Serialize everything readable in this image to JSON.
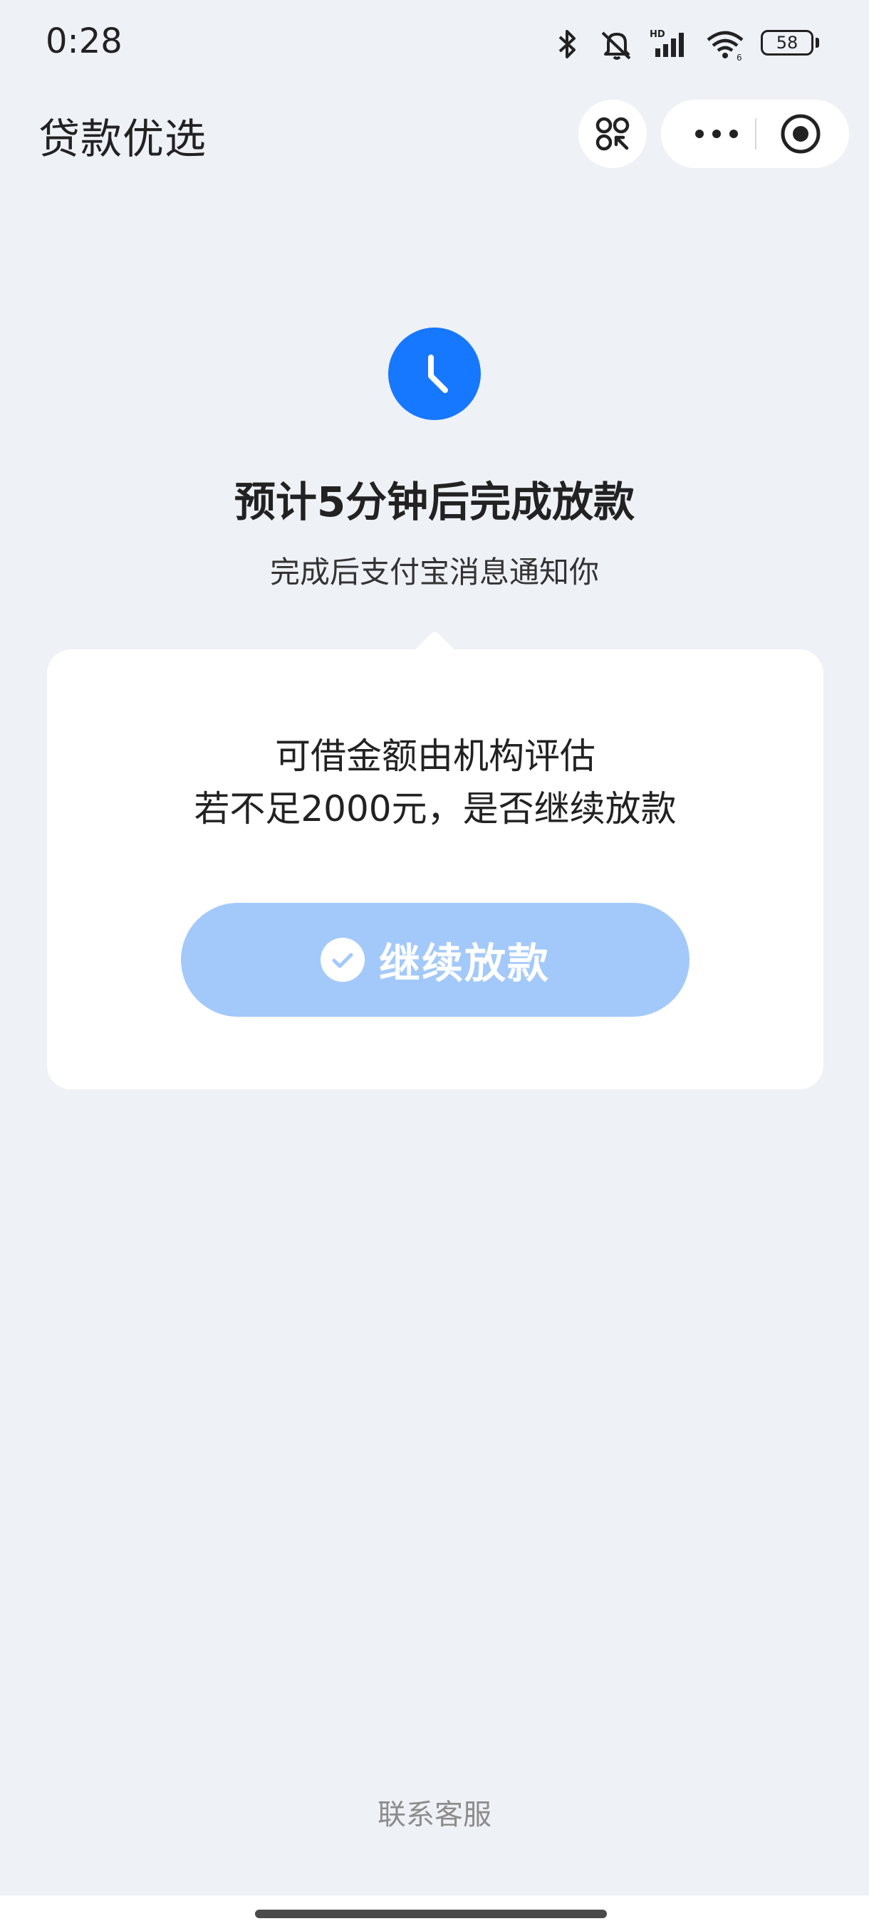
{
  "status_bar": {
    "time": "0:28",
    "battery_level": "58",
    "icons": [
      "bluetooth-icon",
      "mute-icon",
      "signal-icon",
      "wifi-icon",
      "battery-icon"
    ]
  },
  "nav": {
    "title": "贷款优选",
    "icons": [
      "scan-icon",
      "more-icon",
      "close-target-icon"
    ]
  },
  "status": {
    "icon": "clock-icon",
    "title": "预计5分钟后完成放款",
    "subtitle": "完成后支付宝消息通知你"
  },
  "card": {
    "line1": "可借金额由机构评估",
    "line2": "若不足2000元，是否继续放款",
    "button_label": "继续放款",
    "button_icon": "check-circle-icon"
  },
  "footer": {
    "contact_label": "联系客服"
  },
  "colors": {
    "background": "#eef1f6",
    "accent": "#1677ff",
    "button": "#a3c9fa",
    "card": "#ffffff"
  }
}
